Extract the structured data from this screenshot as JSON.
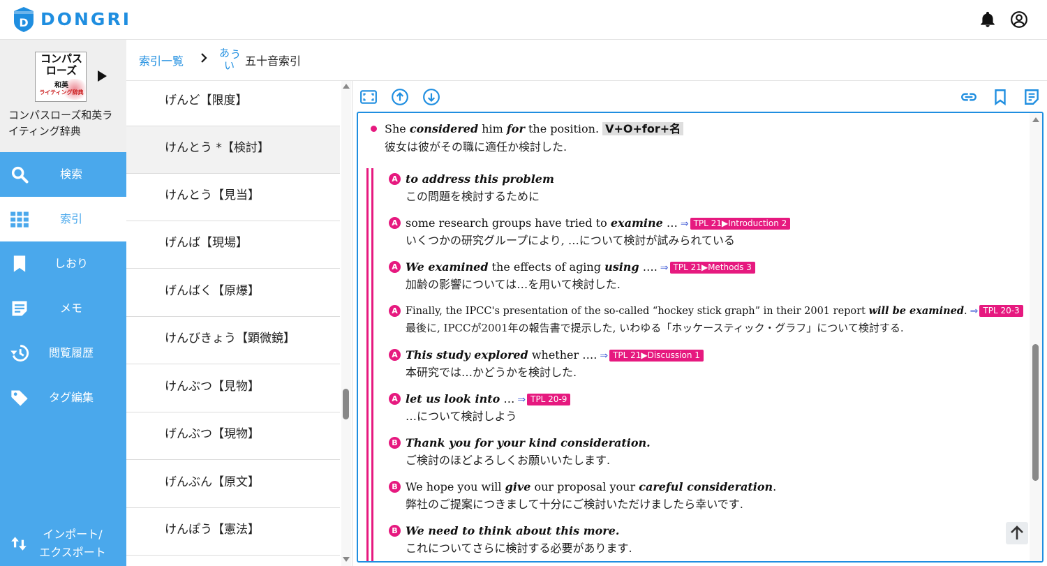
{
  "app": {
    "name": "DONGRI"
  },
  "book": {
    "cover_title": "コンパス\nローズ",
    "cover_sub1": "和英",
    "cover_sub2": "ライティング辞典",
    "title": "コンパスローズ和英ライティング辞典"
  },
  "nav": [
    {
      "label": "検索",
      "icon": "search-icon"
    },
    {
      "label": "索引",
      "icon": "grid-icon"
    },
    {
      "label": "しおり",
      "icon": "bookmark-icon"
    },
    {
      "label": "メモ",
      "icon": "memo-icon"
    },
    {
      "label": "閲覧履歴",
      "icon": "history-icon"
    },
    {
      "label": "タグ編集",
      "icon": "tag-icon"
    }
  ],
  "import_export": {
    "line1": "インポート/",
    "line2": "エクスポート"
  },
  "breadcrumb": {
    "link": "索引一覧",
    "aiu": "あいう",
    "current": "五十音索引"
  },
  "index_items": [
    "げんど【限度】",
    "けんとう *【検討】",
    "けんとう【見当】",
    "げんば【現場】",
    "げんばく【原爆】",
    "けんびきょう【顕微鏡】",
    "けんぶつ【見物】",
    "げんぶつ【現物】",
    "げんぶん【原文】",
    "けんぽう【憲法】"
  ],
  "main_example": {
    "en_1": "She ",
    "en_2": "considered",
    "en_3": " him ",
    "en_4": "for",
    "en_5": " the position. ",
    "pattern": "V+O+for+名",
    "jp": "彼女は彼がその職に適任か検討した."
  },
  "examples": [
    {
      "badge": "A",
      "jp": "この問題を検討するために"
    },
    {
      "badge": "A",
      "jp": "いくつかの研究グループにより, …について検討が試みられている",
      "tpl": "TPL 21▶Introduction 2"
    },
    {
      "badge": "A",
      "jp": "加齢の影響については…を用いて検討した.",
      "tpl": "TPL 21▶Methods 3"
    },
    {
      "badge": "A",
      "jp": "最後に, IPCCが2001年の報告書で提示した, いわゆる「ホッケースティック・グラフ」について検討する.",
      "tpl": "TPL 20-3"
    },
    {
      "badge": "A",
      "jp": "本研究では…かどうかを検討した.",
      "tpl": "TPL 21▶Discussion 1"
    },
    {
      "badge": "A",
      "jp": "…について検討しよう",
      "tpl": "TPL 20-9"
    },
    {
      "badge": "B",
      "jp": "ご検討のほどよろしくお願いいたします."
    },
    {
      "badge": "B",
      "jp": "弊社のご提案につきまして十分にご検討いただけましたら幸いです."
    },
    {
      "badge": "B",
      "jp": "これについてさらに検討する必要があります."
    }
  ],
  "en_segments": {
    "e0": {
      "a": "to address this problem"
    },
    "e1": {
      "a": "some research groups have tried to ",
      "b": "examine",
      "c": " …"
    },
    "e2": {
      "a": "We examined",
      "b": " the effects of aging ",
      "c": "using",
      "d": " …."
    },
    "e3": {
      "a": "Finally, the IPCC's presentation of the so-called “hockey stick graph” in their 2001 report ",
      "b": "will be examined",
      "c": "."
    },
    "e4": {
      "a": "This study explored",
      "b": " whether …."
    },
    "e5": {
      "a": "let us look into",
      "b": " …"
    },
    "e6": {
      "a": "Thank you for your kind consideration."
    },
    "e7": {
      "a": "We hope you will ",
      "b": "give",
      "c": " our proposal your ",
      "d": "careful consideration",
      "e": "."
    },
    "e8": {
      "a": "We need to think about this more."
    }
  },
  "arrow_symbol": "⇒",
  "colors": {
    "accent": "#1f8ee0",
    "sidebar": "#4aa8ec",
    "pink": "#e6197f"
  }
}
